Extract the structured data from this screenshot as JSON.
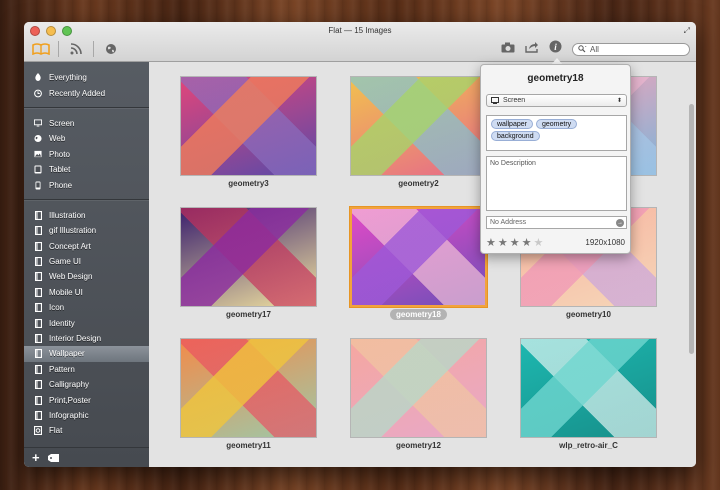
{
  "window": {
    "title": "Flat — 15 Images"
  },
  "toolbar": {
    "left_icons": [
      "library-book-icon",
      "rss-feed-icon",
      "globe-icon"
    ],
    "right_icons": [
      "camera-icon",
      "share-icon",
      "info-icon"
    ],
    "search": {
      "placeholder": "All"
    }
  },
  "sidebar": {
    "groups": [
      [
        {
          "label": "Everything",
          "icon": "everything-icon"
        },
        {
          "label": "Recently Added",
          "icon": "clock-icon"
        }
      ],
      [
        {
          "label": "Screen",
          "icon": "monitor-icon"
        },
        {
          "label": "Web",
          "icon": "web-icon"
        },
        {
          "label": "Photo",
          "icon": "photo-icon"
        },
        {
          "label": "Tablet",
          "icon": "tablet-icon"
        },
        {
          "label": "Phone",
          "icon": "phone-icon"
        }
      ],
      [
        {
          "label": "Illustration",
          "icon": "folder-icon"
        },
        {
          "label": "gif Illustration",
          "icon": "folder-icon"
        },
        {
          "label": "Concept Art",
          "icon": "folder-icon"
        },
        {
          "label": "Game UI",
          "icon": "folder-icon"
        },
        {
          "label": "Web Design",
          "icon": "folder-icon"
        },
        {
          "label": "Mobile UI",
          "icon": "folder-icon"
        },
        {
          "label": "Icon",
          "icon": "folder-icon"
        },
        {
          "label": "Identity",
          "icon": "folder-icon"
        },
        {
          "label": "Interior Design",
          "icon": "folder-icon"
        },
        {
          "label": "Wallpaper",
          "icon": "folder-icon",
          "selected": true
        },
        {
          "label": "Pattern",
          "icon": "folder-icon"
        },
        {
          "label": "Calligraphy",
          "icon": "folder-icon"
        },
        {
          "label": "Print,Poster",
          "icon": "folder-icon"
        },
        {
          "label": "Infographic",
          "icon": "folder-icon"
        },
        {
          "label": "Flat",
          "icon": "smart-folder-icon"
        }
      ]
    ],
    "bottom_icons": [
      "add-icon",
      "tag-icon"
    ]
  },
  "grid": {
    "tiles": [
      {
        "name": "geometry3",
        "colors": [
          "#e2457a",
          "#f07d5a",
          "#8a6fbf",
          "#5a4aa8"
        ]
      },
      {
        "name": "geometry2",
        "colors": [
          "#f2c14e",
          "#a7d36b",
          "#7ac7d9",
          "#e66a8a"
        ]
      },
      {
        "name": "",
        "colors": [
          "#f4a3b8",
          "#e9b6cf",
          "#a6c8e8",
          "#7fb4d8"
        ]
      },
      {
        "name": "geometry17",
        "colors": [
          "#3a1f6e",
          "#8b2aa0",
          "#c7305a",
          "#f1e3a0"
        ]
      },
      {
        "name": "geometry18",
        "colors": [
          "#e24ac6",
          "#9d59d8",
          "#f6c6d8",
          "#6f4fb8"
        ],
        "selected": true
      },
      {
        "name": "geometry10",
        "colors": [
          "#f7b3a0",
          "#f09ab7",
          "#c7a3e0",
          "#f6d6b8"
        ]
      },
      {
        "name": "geometry11",
        "colors": [
          "#f28b4a",
          "#f0c53c",
          "#ea4f62",
          "#9ec8a8"
        ]
      },
      {
        "name": "geometry12",
        "colors": [
          "#f5a7a0",
          "#b8d8c8",
          "#f0c8a0",
          "#e8a8c8"
        ]
      },
      {
        "name": "wlp_retro-air_C",
        "colors": [
          "#1eb8b0",
          "#6fd6cf",
          "#e9f7f5",
          "#168f8a"
        ]
      }
    ]
  },
  "popover": {
    "title": "geometry18",
    "category": "Screen",
    "tags": [
      "wallpaper",
      "geometry",
      "background"
    ],
    "description_placeholder": "No Description",
    "address_placeholder": "No Address",
    "rating": 4,
    "rating_max": 5,
    "dimensions": "1920x1080"
  }
}
